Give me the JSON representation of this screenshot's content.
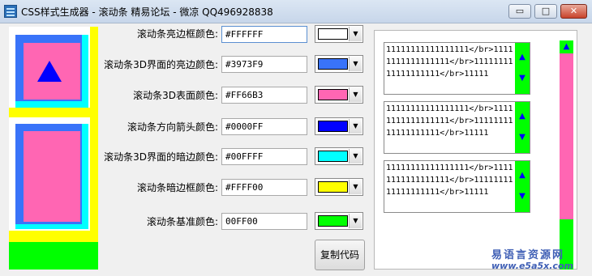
{
  "window": {
    "title": "CSS样式生成器 - 滚动条 精易论坛 - 微凉 QQ496928838",
    "min_glyph": "▭",
    "max_glyph": "□",
    "close_glyph": "✕"
  },
  "colors": {
    "highlight": "#FFFFFF",
    "light3d": "#3973F9",
    "face": "#FF66B3",
    "arrow": "#0000FF",
    "dark3d": "#00FFFF",
    "darkshadow": "#FFFF00",
    "base": "#00FF00"
  },
  "fields": [
    {
      "label": "滚动条亮边框颜色:",
      "value": "#FFFFFF",
      "swatch": "#FFFFFF"
    },
    {
      "label": "滚动条3D界面的亮边颜色:",
      "value": "#3973F9",
      "swatch": "#3973F9"
    },
    {
      "label": "滚动条3D表面颜色:",
      "value": "#FF66B3",
      "swatch": "#FF66B3"
    },
    {
      "label": "滚动条方向箭头颜色:",
      "value": "#0000FF",
      "swatch": "#0000FF"
    },
    {
      "label": "滚动条3D界面的暗边颜色:",
      "value": "#00FFFF",
      "swatch": "#00FFFF"
    },
    {
      "label": "滚动条暗边框颜色:",
      "value": "#FFFF00",
      "swatch": "#FFFF00"
    },
    {
      "label": "滚动条基准颜色:",
      "value": "00FF00",
      "swatch": "#00FF00"
    }
  ],
  "dropdown_glyph": "▼",
  "copy_button": "复制代码",
  "demo_text": "11111111111111111</br>11111111111111111</br>1111111111111111111</br>11111",
  "arrow_up": "▲",
  "arrow_down": "▼",
  "watermark": {
    "line1": "易语言资源网",
    "line2": "www.e5a5x.com"
  }
}
